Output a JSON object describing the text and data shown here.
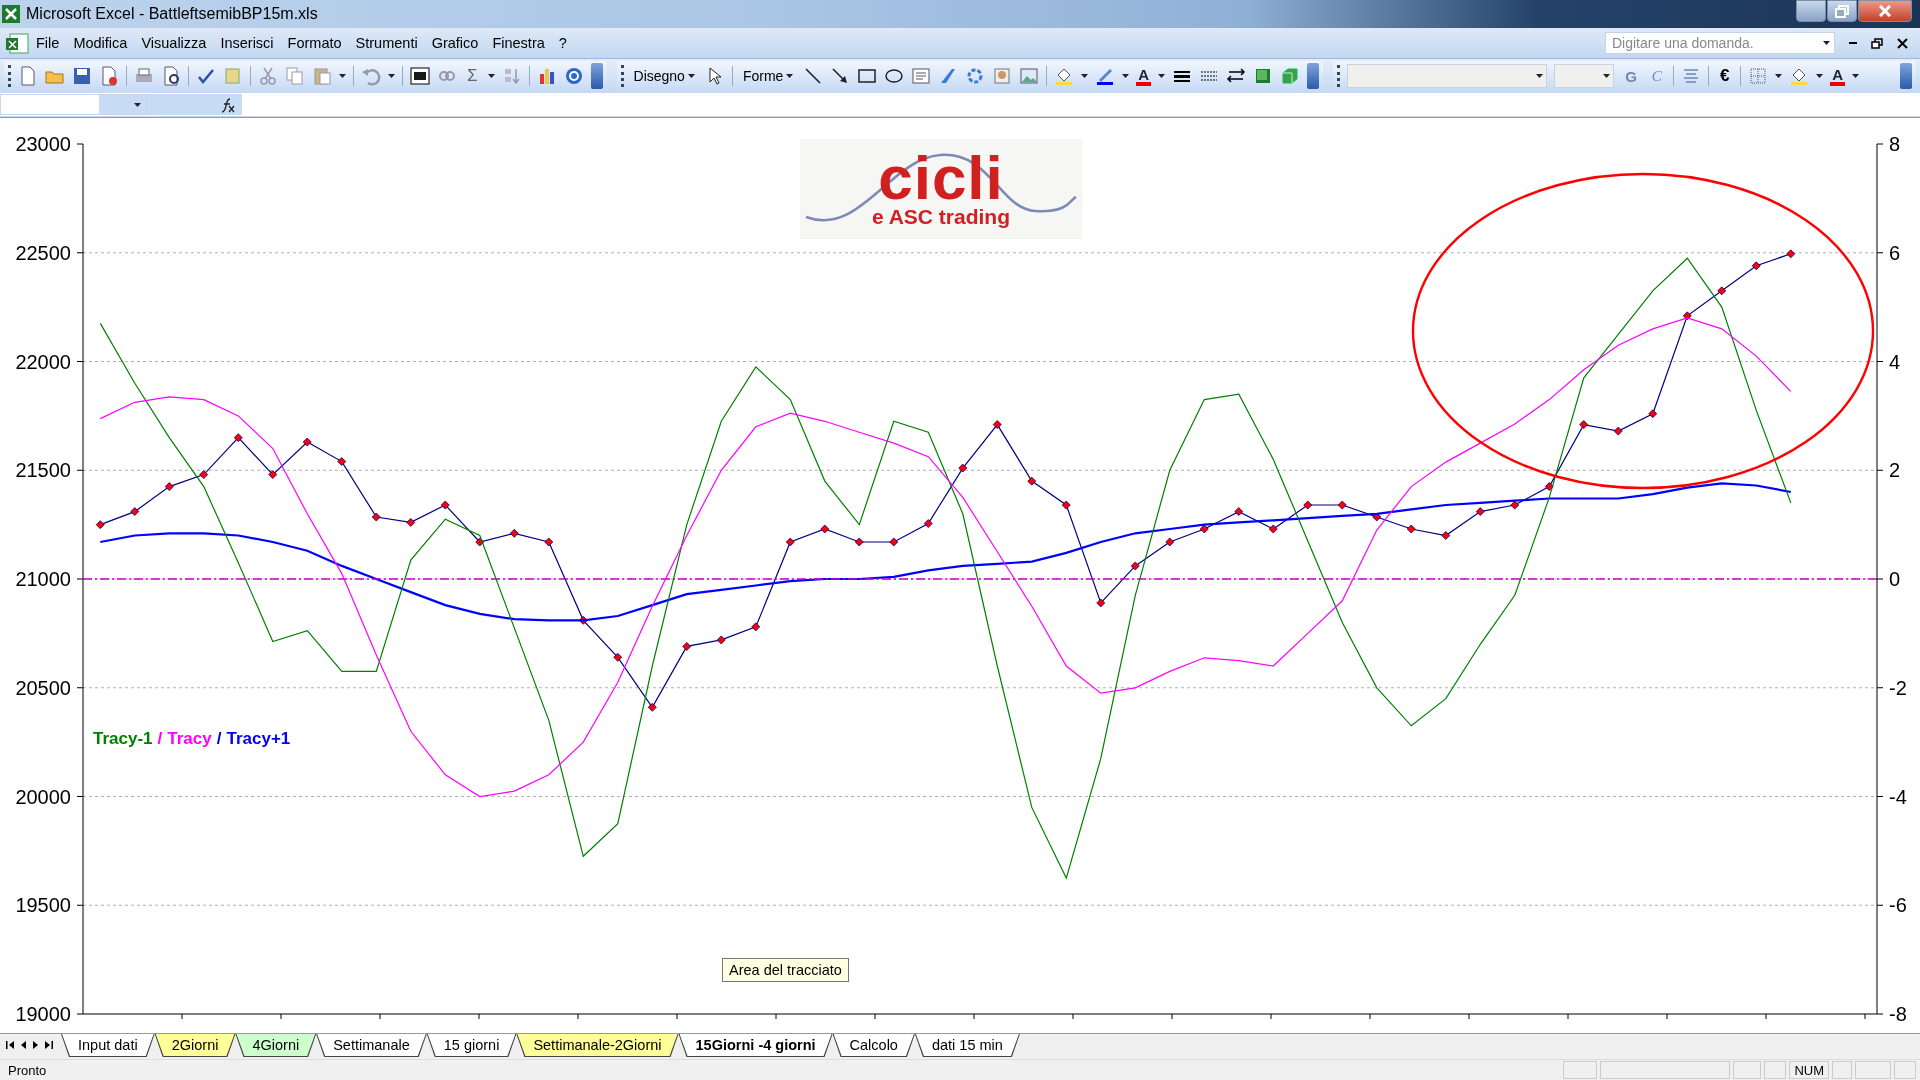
{
  "window": {
    "title": "Microsoft Excel - BattleftsemibBP15m.xls"
  },
  "menu": {
    "items": [
      "File",
      "Modifica",
      "Visualizza",
      "Inserisci",
      "Formato",
      "Strumenti",
      "Grafico",
      "Finestra",
      "?"
    ],
    "help_search": {
      "placeholder": "Digitare una domanda."
    }
  },
  "standard_toolbar": {
    "sum_button": "Σ"
  },
  "drawing_toolbar": {
    "draw_menu": "Disegno",
    "shapes_menu": "Forme",
    "font_color_button": "A"
  },
  "format_toolbar": {
    "bold_button": "G",
    "italic_button": "C",
    "euro_button": "€",
    "font_color_button": "A"
  },
  "chart": {
    "logo": {
      "title": "cicli",
      "subtitle": "e ASC trading"
    },
    "legend_separator": "/",
    "tooltip": "Area del tracciato",
    "chart_data": {
      "type": "line",
      "grid": true,
      "categories": [
        null,
        null,
        null,
        null,
        null,
        null,
        null,
        null,
        null,
        null,
        null,
        null,
        null,
        null,
        null,
        null,
        null,
        null,
        null,
        null,
        null,
        null,
        null,
        null,
        null,
        null,
        null,
        null,
        null,
        null,
        null,
        null,
        null,
        null,
        null,
        null,
        null,
        null,
        null,
        null,
        null,
        null,
        null,
        null,
        null,
        null,
        null,
        null,
        null,
        null,
        null,
        null
      ],
      "ylim": [
        19000,
        23000
      ],
      "yticks": [
        19000,
        19500,
        20000,
        20500,
        21000,
        21500,
        22000,
        22500,
        23000
      ],
      "series": [
        {
          "color": "#000080",
          "marker": "diamond",
          "values": [
            21250,
            21310,
            21425,
            21480,
            21650,
            21480,
            21630,
            21540,
            21285,
            21260,
            21340,
            21170,
            21210,
            21170,
            20810,
            20640,
            20410,
            20690,
            20720,
            20780,
            21170,
            21230,
            21170,
            21170,
            21255,
            21510,
            21710,
            21450,
            21340,
            20890,
            21060,
            21170,
            21230,
            21310,
            21230,
            21340,
            21340,
            21285,
            21230,
            21200,
            21310,
            21340,
            21425,
            21710,
            21680,
            21760,
            22210,
            22325,
            22440,
            22495,
            null,
            null
          ]
        },
        {
          "name": "Tracy+1",
          "color": "#0000ff",
          "values": [
            21170,
            21200,
            21210,
            21210,
            21200,
            21170,
            21130,
            21060,
            21000,
            20940,
            20880,
            20840,
            20815,
            20810,
            20810,
            20830,
            20880,
            20930,
            20950,
            20970,
            20990,
            21000,
            21000,
            21010,
            21040,
            21060,
            21070,
            21080,
            21120,
            21170,
            21210,
            21230,
            21250,
            21260,
            21270,
            21280,
            21290,
            21300,
            21320,
            21340,
            21350,
            21360,
            21370,
            21370,
            21370,
            21390,
            21420,
            21440,
            21430,
            21400,
            null,
            null
          ]
        }
      ]
    },
    "oscillators": {
      "chart_data": {
        "type": "line",
        "categories": [
          null,
          null,
          null,
          null,
          null,
          null,
          null,
          null,
          null,
          null,
          null,
          null,
          null,
          null,
          null,
          null,
          null,
          null,
          null,
          null,
          null,
          null,
          null,
          null,
          null,
          null,
          null,
          null,
          null,
          null,
          null,
          null,
          null,
          null,
          null,
          null,
          null,
          null,
          null,
          null,
          null,
          null,
          null,
          null,
          null,
          null,
          null,
          null,
          null,
          null,
          null,
          null
        ],
        "ylim": [
          -8,
          8
        ],
        "yticks": [
          -8,
          -6,
          -4,
          -2,
          0,
          2,
          4,
          6,
          8
        ],
        "series": [
          {
            "name": "Tracy-1",
            "color": "#008000",
            "values": [
              4.7,
              3.6,
              2.6,
              1.7,
              0.3,
              -1.15,
              -0.95,
              -1.7,
              -1.7,
              0.35,
              1.1,
              0.8,
              -0.9,
              -2.6,
              -5.1,
              -4.5,
              -1.6,
              1.0,
              2.9,
              3.9,
              3.3,
              1.8,
              1.0,
              2.9,
              2.7,
              1.2,
              -1.6,
              -4.2,
              -5.5,
              -3.3,
              -0.3,
              2.0,
              3.3,
              3.4,
              2.2,
              0.7,
              -0.8,
              -2.0,
              -2.7,
              -2.2,
              -1.2,
              -0.3,
              1.5,
              3.7,
              4.5,
              5.3,
              5.9,
              5.0,
              3.1,
              1.4,
              null,
              null
            ]
          },
          {
            "name": "Tracy",
            "color": "#ff00ff",
            "values": [
              2.95,
              3.25,
              3.35,
              3.3,
              3.0,
              2.4,
              1.2,
              0.1,
              -1.4,
              -2.8,
              -3.6,
              -4.0,
              -3.9,
              -3.6,
              -3.0,
              -1.9,
              -0.5,
              0.8,
              2.0,
              2.8,
              3.05,
              2.9,
              2.7,
              2.5,
              2.25,
              1.5,
              0.5,
              -0.5,
              -1.6,
              -2.1,
              -2.0,
              -1.7,
              -1.45,
              -1.5,
              -1.6,
              -1.0,
              -0.4,
              0.9,
              1.7,
              2.15,
              2.5,
              2.85,
              3.3,
              3.85,
              4.3,
              4.6,
              4.8,
              4.6,
              4.1,
              3.45,
              null,
              null
            ]
          }
        ]
      }
    }
  },
  "sheet_tabs": [
    {
      "label": "Input dati",
      "selected": false,
      "color": "#ffffff"
    },
    {
      "label": "2Giorni",
      "selected": false,
      "color": "#ffff99"
    },
    {
      "label": "4Giorni",
      "selected": false,
      "color": "#ccffcc"
    },
    {
      "label": "Settimanale",
      "selected": false,
      "color": "#ffffff"
    },
    {
      "label": "15 giorni",
      "selected": false,
      "color": "#ffffff"
    },
    {
      "label": "Settimanale-2Giorni",
      "selected": false,
      "color": "#ffff99"
    },
    {
      "label": "15Giorni -4 giorni",
      "selected": true,
      "color": "#ffffff"
    },
    {
      "label": "Calcolo",
      "selected": false,
      "color": "#ffffff"
    },
    {
      "label": "dati 15 min",
      "selected": false,
      "color": "#ffffff"
    }
  ],
  "status_bar": {
    "status": "Pronto",
    "indicators": [
      "NUM"
    ]
  }
}
